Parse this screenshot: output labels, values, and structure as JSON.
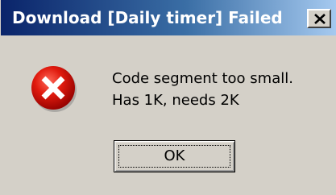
{
  "window": {
    "title": "Download [Daily timer] Failed",
    "close_icon": "close-icon"
  },
  "icon": {
    "name": "error-icon",
    "color": "#d40000"
  },
  "message": {
    "line1": "Code segment too small.",
    "line2": "Has 1K, needs 2K"
  },
  "buttons": {
    "ok_label": "OK"
  },
  "colors": {
    "titlebar_start": "#0a246a",
    "titlebar_end": "#a6caf0",
    "dialog_bg": "#d4d0c8"
  }
}
